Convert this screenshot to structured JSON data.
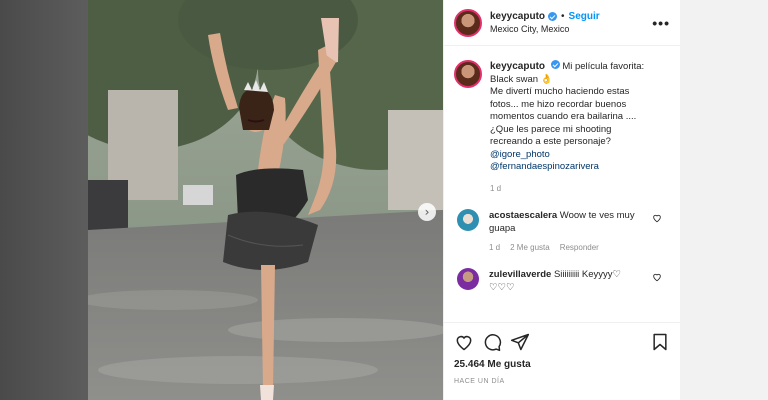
{
  "post": {
    "username": "keyycaputo",
    "follow_label": "Seguir",
    "location": "Mexico City, Mexico",
    "more_icon": "•••"
  },
  "caption": {
    "username": "keyycaputo",
    "lines": [
      "Mi película favorita:",
      "Black swan 👌",
      "Me divertí mucho haciendo estas",
      "fotos... me hizo recordar buenos",
      "momentos cuando era bailarina ....",
      "¿Que les parece mi shooting",
      "recreando a este personaje?"
    ],
    "mentions": [
      "@igore_photo",
      "@fernandaespinozarivera"
    ],
    "time": "1 d"
  },
  "comments": [
    {
      "username": "acostaescalera",
      "text": "Woow te ves muy guapa",
      "time": "1 d",
      "likes": "2 Me gusta",
      "reply": "Responder",
      "avatar_color": "#2f8fb0"
    },
    {
      "username": "zulevillaverde",
      "text": "Siiiiiiiii Keyyyy♡ ♡♡♡",
      "avatar_color": "#7a2ca0"
    }
  ],
  "actions": {
    "likes_count": "25.464 Me gusta",
    "time_ago": "HACE UN DÍA"
  },
  "colors": {
    "accent": "#0095f6",
    "verified": "#3897f0",
    "mention": "#00376b"
  }
}
